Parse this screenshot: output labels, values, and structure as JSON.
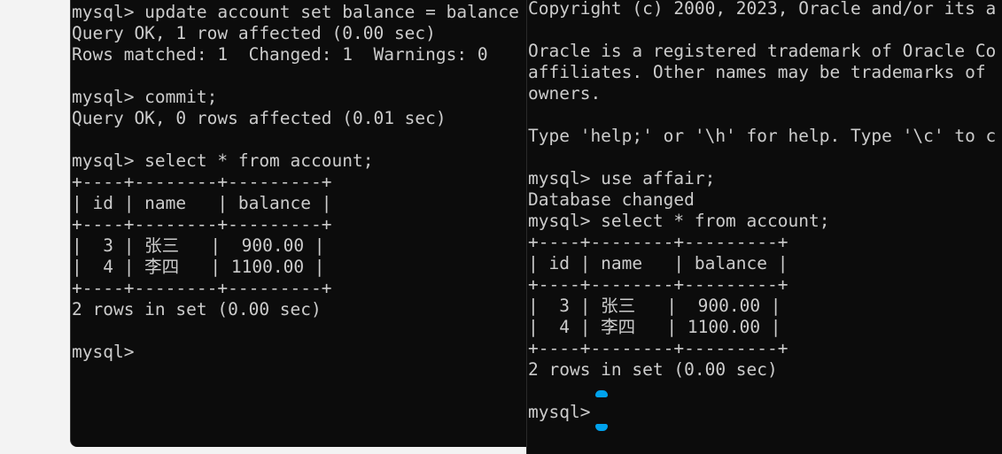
{
  "left_terminal": {
    "lines": [
      "",
      "mysql> update account set balance = balance",
      "Query OK, 1 row affected (0.00 sec)",
      "Rows matched: 1  Changed: 1  Warnings: 0",
      "",
      "mysql> commit;",
      "Query OK, 0 rows affected (0.01 sec)",
      "",
      "mysql> select * from account;",
      "+----+--------+---------+",
      "| id | name   | balance |",
      "+----+--------+---------+",
      "|  3 | 张三   |  900.00 |",
      "|  4 | 李四   | 1100.00 |",
      "+----+--------+---------+",
      "2 rows in set (0.00 sec)",
      "",
      "mysql>"
    ]
  },
  "right_terminal": {
    "lines": [
      "Copyright (c) 2000, 2023, Oracle and/or its a",
      "",
      "Oracle is a registered trademark of Oracle Co",
      "affiliates. Other names may be trademarks of",
      "owners.",
      "",
      "Type 'help;' or '\\h' for help. Type '\\c' to c",
      "",
      "mysql> use affair;",
      "Database changed",
      "mysql> select * from account;",
      "+----+--------+---------+",
      "| id | name   | balance |",
      "+----+--------+---------+",
      "|  3 | 张三   |  900.00 |",
      "|  4 | 李四   | 1100.00 |",
      "+----+--------+---------+",
      "2 rows in set (0.00 sec)",
      "",
      "mysql>"
    ]
  },
  "colors": {
    "terminal_bg": "#0c0c0c",
    "terminal_text": "#cccccc",
    "cursor_accent": "#00a2ed"
  }
}
